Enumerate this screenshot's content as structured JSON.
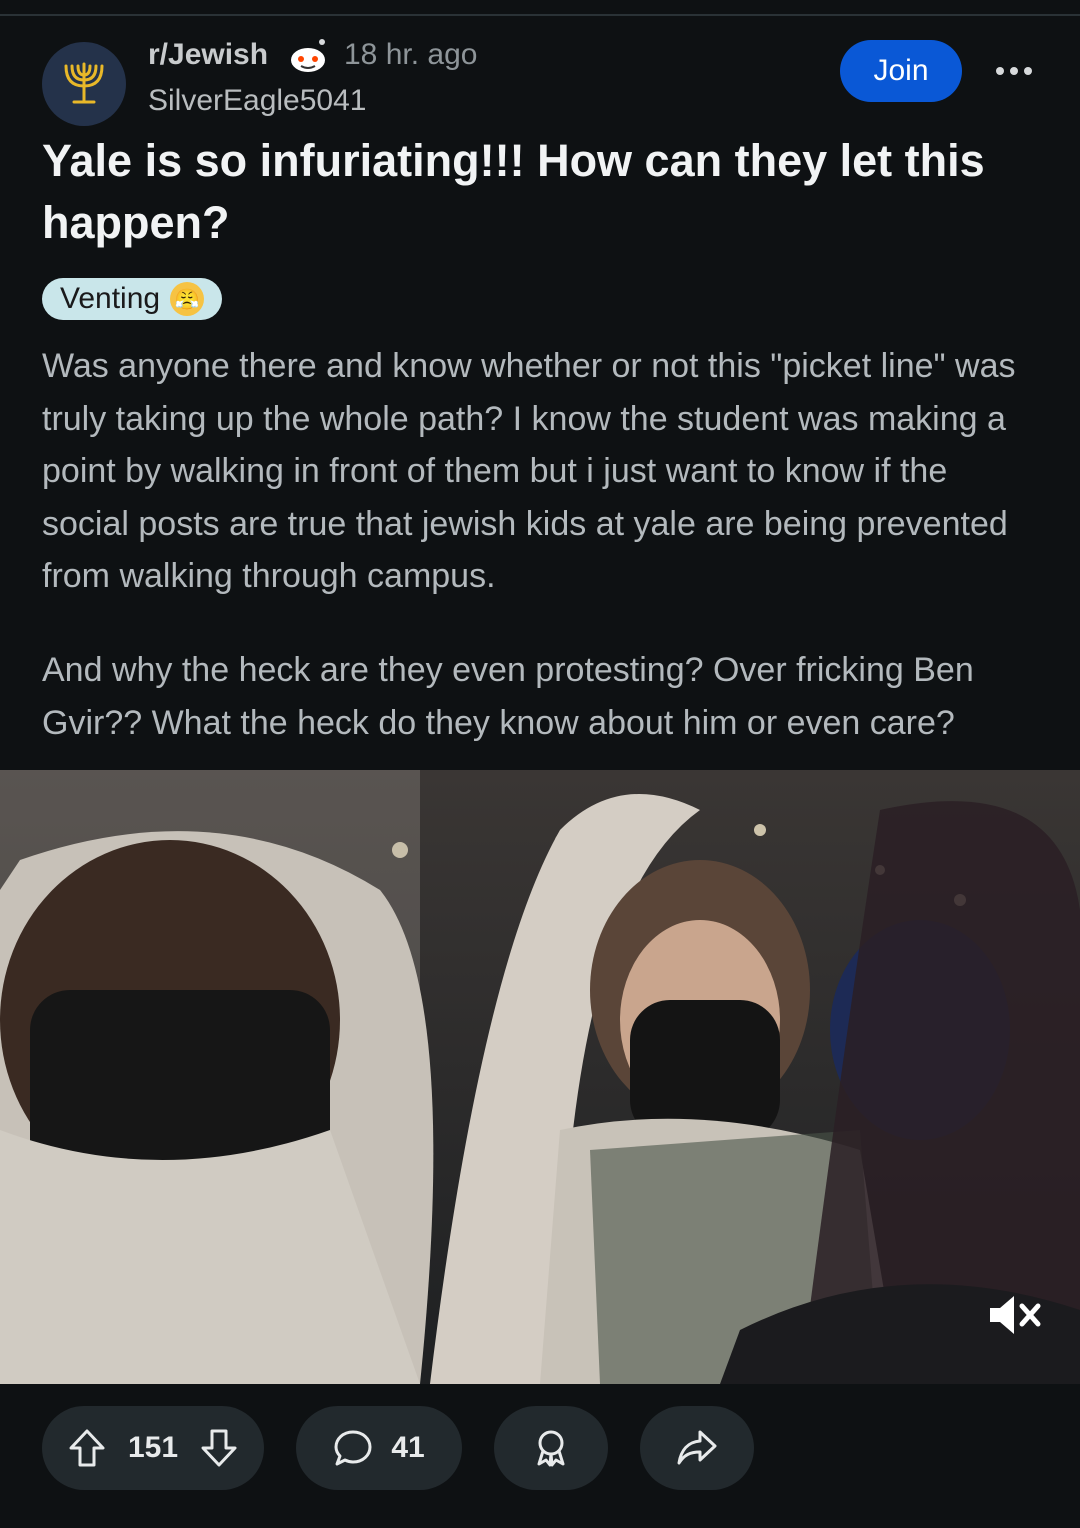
{
  "post": {
    "subreddit": "r/Jewish",
    "time_ago": "18 hr. ago",
    "author": "SilverEagle5041",
    "join_label": "Join",
    "title": "Yale is so infuriating!!! How can they let this happen?",
    "flair": "Venting",
    "body_paragraphs": [
      "Was anyone there and know whether or not this \"picket line\" was truly taking up the whole path? I know the student was making a point by walking in front of them but i just want to know if the social posts are true that jewish kids at yale are being prevented from walking through campus.",
      "And why the heck are they even protesting? Over fricking Ben Gvir?? What the heck do they know about him or even care?"
    ]
  },
  "media": {
    "video_muted": true
  },
  "actions": {
    "upvotes": "151",
    "comments": "41"
  },
  "icons": {
    "subreddit_avatar": "menorah-icon",
    "join_color": "#0a58d6",
    "flair_color": "#c9e6ea"
  }
}
